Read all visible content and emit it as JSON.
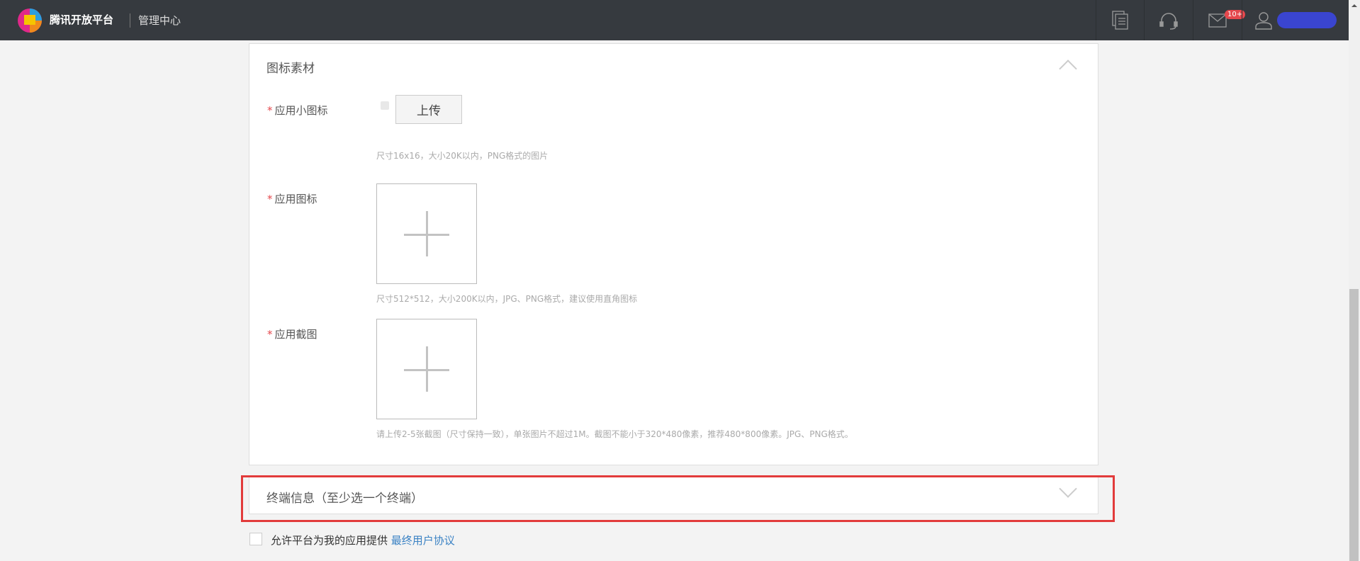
{
  "header": {
    "brand": "腾讯开放平台",
    "subtitle": "管理中心",
    "mail_badge": "10+",
    "icons": [
      "docs-icon",
      "support-headset-icon",
      "mail-icon",
      "user-icon"
    ]
  },
  "icon_panel": {
    "title": "图标素材",
    "small_icon": {
      "label": "应用小图标",
      "upload": "上传",
      "hint": "尺寸16x16，大小20K以内，PNG格式的图片"
    },
    "app_icon": {
      "label": "应用图标",
      "hint": "尺寸512*512，大小200K以内，JPG、PNG格式，建议使用直角图标"
    },
    "screenshots": {
      "label": "应用截图",
      "hint": "请上传2-5张截图（尺寸保持一致），单张图片不超过1M。截图不能小于320*480像素，推荐480*800像素。JPG、PNG格式。"
    },
    "required_mark": "*"
  },
  "terminal_panel": {
    "title": "终端信息（至少选一个终端）"
  },
  "agreement": {
    "text": "允许平台为我的应用提供",
    "link": "最终用户协议",
    "checked": false
  },
  "colors": {
    "header": "#363a3f",
    "highlight": "#e23b3b",
    "link": "#3a82c4",
    "badge": "#e5484d"
  }
}
